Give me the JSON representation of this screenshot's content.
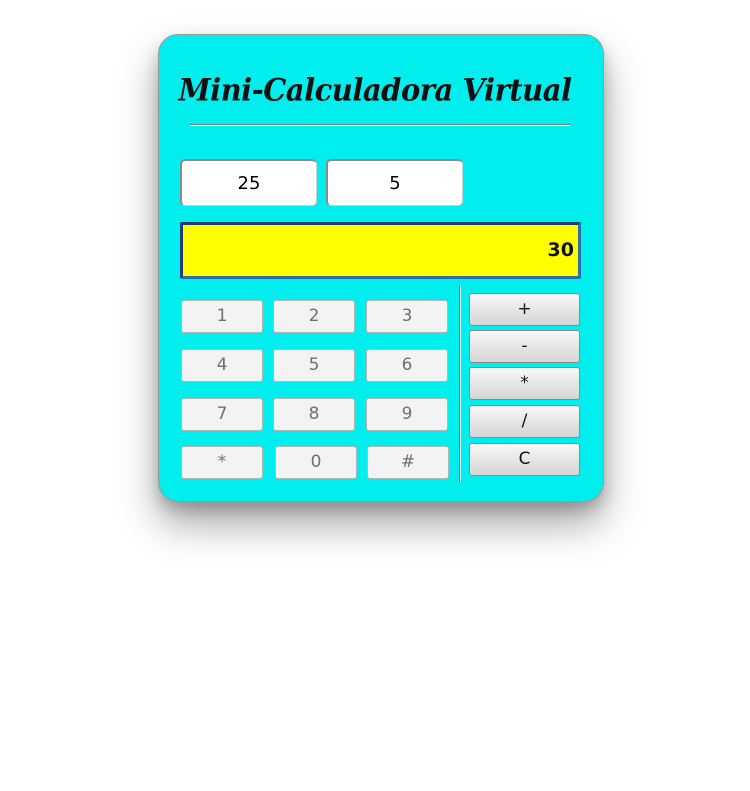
{
  "title": "Mini-Calculadora Virtual",
  "inputs": {
    "first_value": "25",
    "second_value": "5"
  },
  "display": {
    "result": "30",
    "background_color": "#ffff00"
  },
  "keypad": {
    "rows": [
      [
        "1",
        "2",
        "3"
      ],
      [
        "4",
        "5",
        "6"
      ],
      [
        "7",
        "8",
        "9"
      ],
      [
        "*",
        "0",
        "#"
      ]
    ]
  },
  "operations": [
    "+",
    "-",
    "*",
    "/",
    "C"
  ],
  "colors": {
    "panel_background": "#00eeee",
    "display_background": "#ffff00",
    "display_border": "#2e6fa8"
  }
}
